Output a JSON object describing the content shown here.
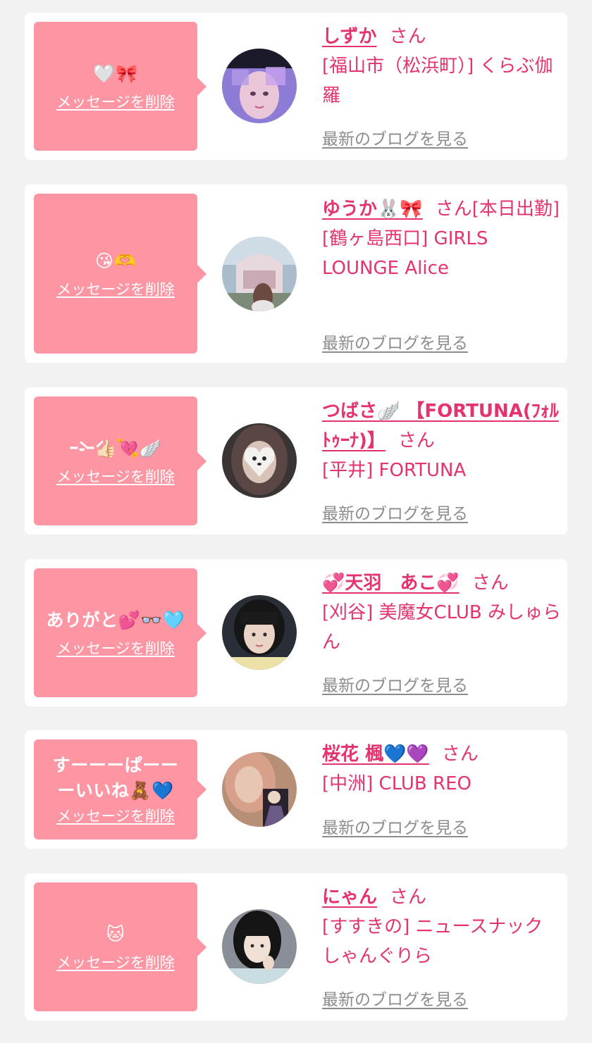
{
  "colors": {
    "page_bg": "#f2f2f2",
    "card_bg": "#ffffff",
    "bubble_bg": "#fd95a3",
    "accent": "#e4336f",
    "link_gray": "#8c8c8c"
  },
  "common": {
    "delete_label": "メッセージを削除",
    "san_label": "さん",
    "blog_label": "最新のブログを見る"
  },
  "items": [
    {
      "message": "🤍🎀",
      "name": "しずか",
      "status": "",
      "shop": "[福山市（松浜町）] くらぶ伽羅",
      "avatar_icon": "avatar-photo"
    },
    {
      "message": "😘🫶",
      "name": "ゆうか🐰🎀",
      "status": "[本日出勤]",
      "shop": "[鶴ヶ島西口] GIRLS LOUNGE Alice",
      "avatar_icon": "avatar-photo"
    },
    {
      "message": "ｰ̀֊ｰ́👍🏻💘🪽",
      "name": "つばさ🪽 【FORTUNA(ﾌｫﾙﾄｩｰﾅ)】",
      "status": "",
      "shop": "[平井] FORTUNA",
      "avatar_icon": "avatar-photo"
    },
    {
      "message": "ありがと💕👓🩵",
      "name": "💞天羽　あこ💞",
      "status": "",
      "shop": "[刈谷] 美魔女CLUB みしゅらん",
      "avatar_icon": "avatar-photo"
    },
    {
      "message": "すーーーぱーーーいいね🧸💙",
      "name": "桜花 楓💙💜",
      "status": "",
      "shop": "[中洲] CLUB REO",
      "avatar_icon": "avatar-photo"
    },
    {
      "message": "🐱",
      "name": "にゃん",
      "status": "",
      "shop": "[すすきの] ニュースナック しゃんぐりら",
      "avatar_icon": "avatar-photo"
    }
  ]
}
